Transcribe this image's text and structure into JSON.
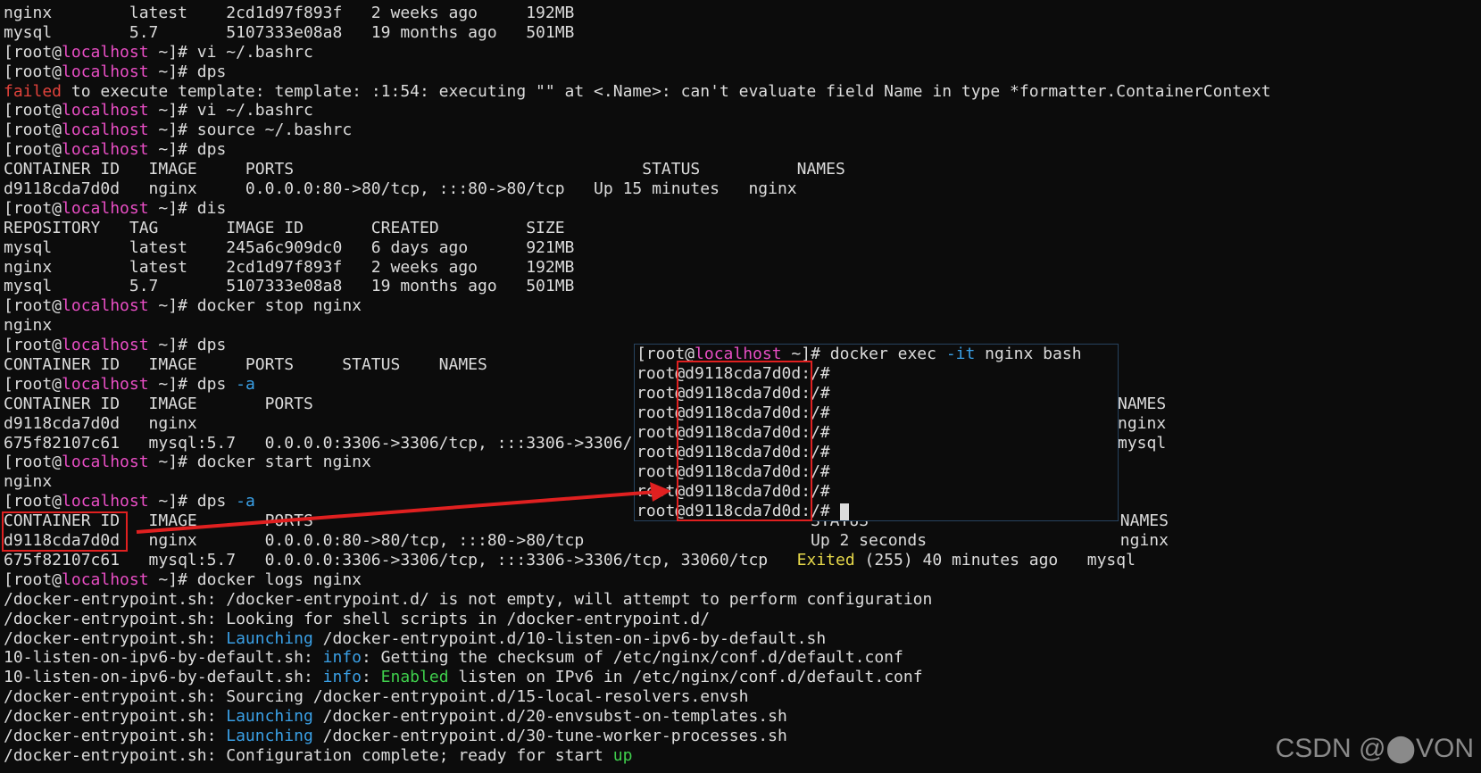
{
  "prompt": {
    "open": "[root@",
    "host": "localhost",
    "close": " ~]# "
  },
  "colors": {
    "background": "#0c0c0c",
    "text": "#dcdcdc",
    "host": "#e84ec4",
    "error": "#e0423b",
    "info": "#3aa0e6",
    "enabled": "#3fcf4c",
    "exited": "#e6d84a",
    "annotation": "#e02020"
  },
  "lines": {
    "l00": "nginx        latest    2cd1d97f893f   2 weeks ago     192MB",
    "l01": "mysql        5.7       5107333e08a8   19 months ago   501MB",
    "l02_cmd": "vi ~/.bashrc",
    "l03_cmd": "dps",
    "l04_failed": "failed",
    "l04_rest": " to execute template: template: :1:54: executing \"\" at <.Name>: can't evaluate field Name in type *formatter.ContainerContext",
    "l05_cmd": "vi ~/.bashrc",
    "l06_cmd": "source ~/.bashrc",
    "l07_cmd": "dps",
    "l08": "CONTAINER ID   IMAGE     PORTS                                    STATUS          NAMES",
    "l09": "d9118cda7d0d   nginx     0.0.0.0:80->80/tcp, :::80->80/tcp   Up 15 minutes   nginx",
    "l10_cmd": "dis",
    "l11": "REPOSITORY   TAG       IMAGE ID       CREATED         SIZE",
    "l12": "mysql        latest    245a6c909dc0   6 days ago      921MB",
    "l13": "nginx        latest    2cd1d97f893f   2 weeks ago     192MB",
    "l14": "mysql        5.7       5107333e08a8   19 months ago   501MB",
    "l15_cmd": "docker stop nginx",
    "l16": "nginx",
    "l17_cmd": "dps",
    "l18": "CONTAINER ID   IMAGE     PORTS     STATUS    NAMES",
    "l19_cmd": "dps ",
    "l19_flag": "-a",
    "l20": "CONTAINER ID   IMAGE       PORTS",
    "l20_tail": "NAMES",
    "l21": "d9118cda7d0d   nginx",
    "l21_tail": "nginx",
    "l22": "675f82107c61   mysql:5.7   0.0.0.0:3306->3306/tcp, :::3306->3306/",
    "l22_tail": "mysql",
    "l23_cmd": "docker start nginx",
    "l24": "nginx",
    "l25_cmd": "dps ",
    "l25_flag": "-a",
    "l26_head": "CONTAINER ID   IMAGE       PORTS",
    "l26_tail": "STATUS                          NAMES",
    "l27_head": "d9118cda7d0d   nginx       0.0.0.0:80->80/tcp, :::80->80/tcp",
    "l27_tail": "Up 2 seconds                    nginx",
    "l28_head": "675f82107c61   mysql:5.7   0.0.0.0:3306->3306/tcp, :::3306->3306/tcp, 33060/tcp   ",
    "l28_exited": "Exited",
    "l28_tail": " (255) 40 minutes ago   mysql",
    "l29_cmd": "docker logs nginx",
    "l30": "/docker-entrypoint.sh: /docker-entrypoint.d/ is not empty, will attempt to perform configuration",
    "l31": "/docker-entrypoint.sh: Looking for shell scripts in /docker-entrypoint.d/",
    "l32_pre": "/docker-entrypoint.sh: ",
    "l32_kw": "Launching",
    "l32_post": " /docker-entrypoint.d/10-listen-on-ipv6-by-default.sh",
    "l33_pre": "10-listen-on-ipv6-by-default.sh: ",
    "l33_kw": "info",
    "l33_post": ": Getting the checksum of /etc/nginx/conf.d/default.conf",
    "l34_pre": "10-listen-on-ipv6-by-default.sh: ",
    "l34_kw": "info",
    "l34_mid": ": ",
    "l34_kw2": "Enabled",
    "l34_post": " listen on IPv6 in /etc/nginx/conf.d/default.conf",
    "l35": "/docker-entrypoint.sh: Sourcing /docker-entrypoint.d/15-local-resolvers.envsh",
    "l36_pre": "/docker-entrypoint.sh: ",
    "l36_kw": "Launching",
    "l36_post": " /docker-entrypoint.d/20-envsubst-on-templates.sh",
    "l37_pre": "/docker-entrypoint.sh: ",
    "l37_kw": "Launching",
    "l37_post": " /docker-entrypoint.d/30-tune-worker-processes.sh",
    "l38_pre": "/docker-entrypoint.sh: Configuration complete; ready for start ",
    "l38_kw": "up"
  },
  "overlay": {
    "cmd_pre": "docker exec ",
    "cmd_flag": "-it",
    "cmd_post": " nginx bash",
    "inner_prompt": "root@d9118cda7d0d:/# "
  },
  "watermark": "CSDN @⬤VON"
}
